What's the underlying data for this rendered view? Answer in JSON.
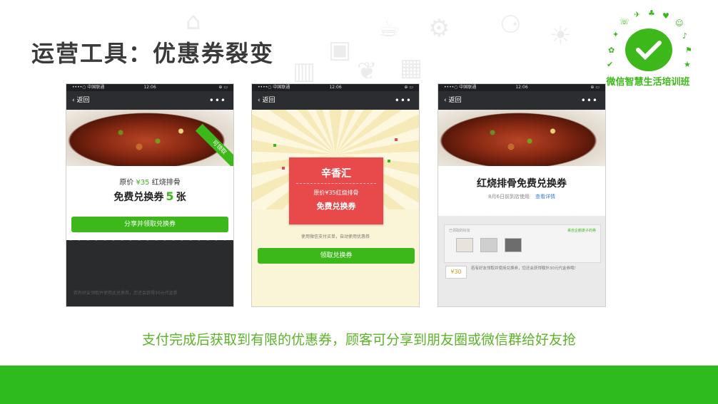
{
  "slide": {
    "title": "运营工具：优惠券裂变",
    "caption": "支付完成后获取到有限的优惠券，顾客可分享到朋友圈或微信群给好友抢",
    "accent_color": "#3cb81a",
    "bottom_bar_color": "#2dbb1d"
  },
  "logo": {
    "text": "微信智慧生活培训班",
    "icon": "wechat-chat-bubble-icon"
  },
  "phones": {
    "status": {
      "carrier": "••••○ 中国联通 ",
      "time": "12:06",
      "battery": "⊕ ▭"
    },
    "nav": {
      "back": "‹ 返回",
      "more": "•••"
    },
    "p1": {
      "ribbon": "可领取",
      "price_line": {
        "prefix": "原价",
        "price": "¥35",
        "item": "红烧排骨"
      },
      "main_line": {
        "prefix": "免费兑换券",
        "count": "5",
        "suffix": "张"
      },
      "button": "分享并领取兑换券",
      "footer": "若有好友领取并使用此兑换券，您还会获得30元代金券"
    },
    "p2": {
      "brand": "辛香汇",
      "coupon_line1": "原价¥35红烧排骨",
      "coupon_line2": "免费兑换券",
      "hint": "使用微信支付买单，自动使用优惠券",
      "button": "领取兑换券"
    },
    "p3": {
      "title": "红烧排骨免费兑换券",
      "subtitle": "8月6日前到店使用",
      "link": "查看详情",
      "friends_label": "已领取的好友",
      "friends_link": "来自企鹅弟子的券",
      "reward_amount": "¥30",
      "reward_text": "若有好友领取并使用兑换券，您还会获得额外30元代金券哦！"
    }
  }
}
